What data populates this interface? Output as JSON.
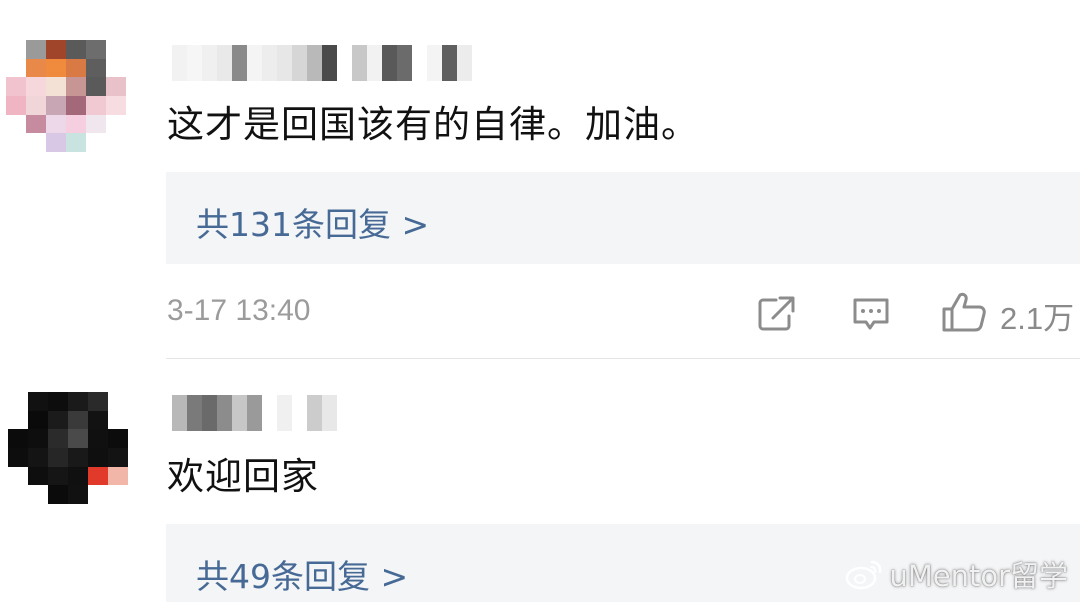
{
  "colors": {
    "background": "#ffffff",
    "text": "#111111",
    "link": "#466a95",
    "meta": "#9b9b9b",
    "reply_box": "#f4f5f7"
  },
  "comments": [
    {
      "text": "这才是回国该有的自律。加油。",
      "reply_link": "共131条回复 >",
      "timestamp": "3-17 13:40",
      "likes": "2.1万",
      "actions": [
        "share-icon",
        "comment-icon",
        "like-icon"
      ]
    },
    {
      "text": "欢迎回家",
      "reply_link": "共49条回复 >"
    }
  ],
  "watermark": {
    "text": "uMentor留学",
    "icon": "weibo-logo-icon"
  }
}
